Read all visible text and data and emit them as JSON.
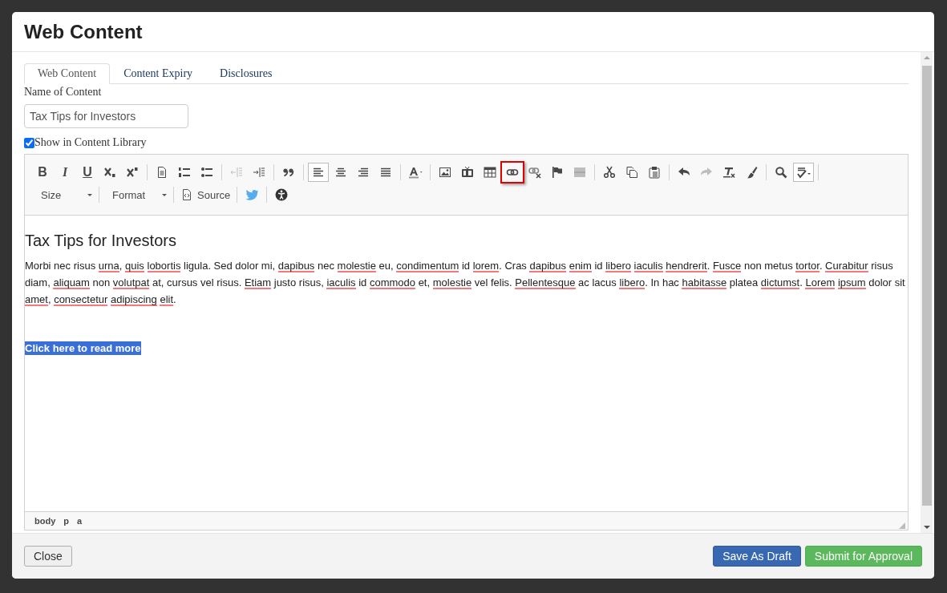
{
  "window": {
    "title": "Web Content"
  },
  "tabs": [
    {
      "label": "Web Content",
      "selected": true
    },
    {
      "label": "Content Expiry",
      "selected": false
    },
    {
      "label": "Disclosures",
      "selected": false
    }
  ],
  "name_field": {
    "label": "Name of Content",
    "value": "Tax Tips for Investors"
  },
  "library_checkbox": {
    "label": "Show in Content Library",
    "checked": true
  },
  "toolbar": {
    "groups": [
      [
        {
          "label": "B",
          "selected": false,
          "disabled": false,
          "highlighted": false
        },
        {
          "label": "I",
          "selected": false,
          "disabled": false,
          "highlighted": false
        },
        {
          "label": "U",
          "selected": false,
          "disabled": false,
          "highlighted": false
        },
        {
          "selected": false,
          "disabled": false,
          "highlighted": false
        },
        {
          "selected": false,
          "disabled": false,
          "highlighted": false
        }
      ],
      [
        {
          "selected": false,
          "disabled": false,
          "highlighted": false
        },
        {
          "selected": false,
          "disabled": false,
          "highlighted": false
        },
        {
          "selected": false,
          "disabled": false,
          "highlighted": false
        }
      ],
      [
        {
          "selected": false,
          "disabled": true,
          "highlighted": false
        },
        {
          "selected": false,
          "disabled": false,
          "highlighted": false
        }
      ],
      [
        {
          "selected": false,
          "disabled": false,
          "highlighted": false
        }
      ],
      [
        {
          "selected": true,
          "disabled": false,
          "highlighted": false
        },
        {
          "selected": false,
          "disabled": false,
          "highlighted": false
        },
        {
          "selected": false,
          "disabled": false,
          "highlighted": false
        },
        {
          "selected": false,
          "disabled": false,
          "highlighted": false
        }
      ],
      [
        {
          "selected": false,
          "disabled": false,
          "highlighted": false
        }
      ],
      [
        {
          "selected": false,
          "disabled": false,
          "highlighted": false
        },
        {
          "selected": false,
          "disabled": false,
          "highlighted": false
        },
        {
          "selected": false,
          "disabled": false,
          "highlighted": false
        },
        {
          "selected": false,
          "disabled": false,
          "highlighted": true
        },
        {
          "selected": false,
          "disabled": false,
          "highlighted": false
        },
        {
          "selected": false,
          "disabled": false,
          "highlighted": false
        },
        {
          "selected": false,
          "disabled": true,
          "highlighted": false
        }
      ],
      [
        {
          "selected": false,
          "disabled": false,
          "highlighted": false
        },
        {
          "selected": false,
          "disabled": false,
          "highlighted": false
        },
        {
          "selected": false,
          "disabled": false,
          "highlighted": false
        }
      ],
      [
        {
          "selected": false,
          "disabled": false,
          "highlighted": false
        },
        {
          "selected": false,
          "disabled": true,
          "highlighted": false
        },
        {
          "selected": false,
          "disabled": false,
          "highlighted": false
        },
        {
          "selected": false,
          "disabled": false,
          "highlighted": false
        }
      ],
      [
        {
          "selected": false,
          "disabled": false,
          "highlighted": false
        },
        {
          "selected": true,
          "disabled": false,
          "highlighted": false
        }
      ]
    ],
    "combos": [
      {
        "label": "Size"
      },
      {
        "label": "Format"
      }
    ],
    "source_button": {
      "label": "Source"
    }
  },
  "editor": {
    "heading": "Tax Tips for Investors",
    "paragraph": [
      {
        "text": "Morbi nec risus ",
        "misspelled": false
      },
      {
        "text": "urna",
        "misspelled": true
      },
      {
        "text": ", ",
        "misspelled": false
      },
      {
        "text": "quis lobortis",
        "misspelled": true
      },
      {
        "text": " ligula. Sed dolor mi, ",
        "misspelled": false
      },
      {
        "text": "dapibus",
        "misspelled": true
      },
      {
        "text": " nec ",
        "misspelled": false
      },
      {
        "text": "molestie",
        "misspelled": true
      },
      {
        "text": " eu, ",
        "misspelled": false
      },
      {
        "text": "condimentum",
        "misspelled": true
      },
      {
        "text": " id ",
        "misspelled": false
      },
      {
        "text": "lorem",
        "misspelled": true
      },
      {
        "text": ". Cras ",
        "misspelled": false
      },
      {
        "text": "dapibus enim",
        "misspelled": true
      },
      {
        "text": " id ",
        "misspelled": false
      },
      {
        "text": "libero iaculis hendrerit",
        "misspelled": true
      },
      {
        "text": ". ",
        "misspelled": false
      },
      {
        "text": "Fusce",
        "misspelled": true
      },
      {
        "text": " non metus ",
        "misspelled": false
      },
      {
        "text": "tortor",
        "misspelled": true
      },
      {
        "text": ". ",
        "misspelled": false
      },
      {
        "text": "Curabitur",
        "misspelled": true
      },
      {
        "text": " risus diam, ",
        "misspelled": false
      },
      {
        "text": "aliquam",
        "misspelled": true
      },
      {
        "text": " non ",
        "misspelled": false
      },
      {
        "text": "volutpat",
        "misspelled": true
      },
      {
        "text": " at, cursus vel risus. ",
        "misspelled": false
      },
      {
        "text": "Etiam",
        "misspelled": true
      },
      {
        "text": " justo risus, ",
        "misspelled": false
      },
      {
        "text": "iaculis",
        "misspelled": true
      },
      {
        "text": " id ",
        "misspelled": false
      },
      {
        "text": "commodo",
        "misspelled": true
      },
      {
        "text": " et, ",
        "misspelled": false
      },
      {
        "text": "molestie",
        "misspelled": true
      },
      {
        "text": " vel felis. ",
        "misspelled": false
      },
      {
        "text": "Pellentesque",
        "misspelled": true
      },
      {
        "text": " ac lacus ",
        "misspelled": false
      },
      {
        "text": "libero",
        "misspelled": true
      },
      {
        "text": ". In hac ",
        "misspelled": false
      },
      {
        "text": "habitasse",
        "misspelled": true
      },
      {
        "text": " platea ",
        "misspelled": false
      },
      {
        "text": "dictumst",
        "misspelled": true
      },
      {
        "text": ". ",
        "misspelled": false
      },
      {
        "text": "Lorem ipsum",
        "misspelled": true
      },
      {
        "text": " dolor sit ",
        "misspelled": false
      },
      {
        "text": "amet",
        "misspelled": true
      },
      {
        "text": ", ",
        "misspelled": false
      },
      {
        "text": "consectetur adipiscing elit",
        "misspelled": true
      },
      {
        "text": ".",
        "misspelled": false
      }
    ],
    "link": {
      "text": "Click here to read more",
      "selected": true
    }
  },
  "element_path": [
    "body",
    "p",
    "a"
  ],
  "buttons": [
    {
      "label": "Close",
      "kind": "default"
    },
    {
      "label": "Save As Draft",
      "kind": "primary"
    },
    {
      "label": "Submit for Approval",
      "kind": "success"
    }
  ]
}
